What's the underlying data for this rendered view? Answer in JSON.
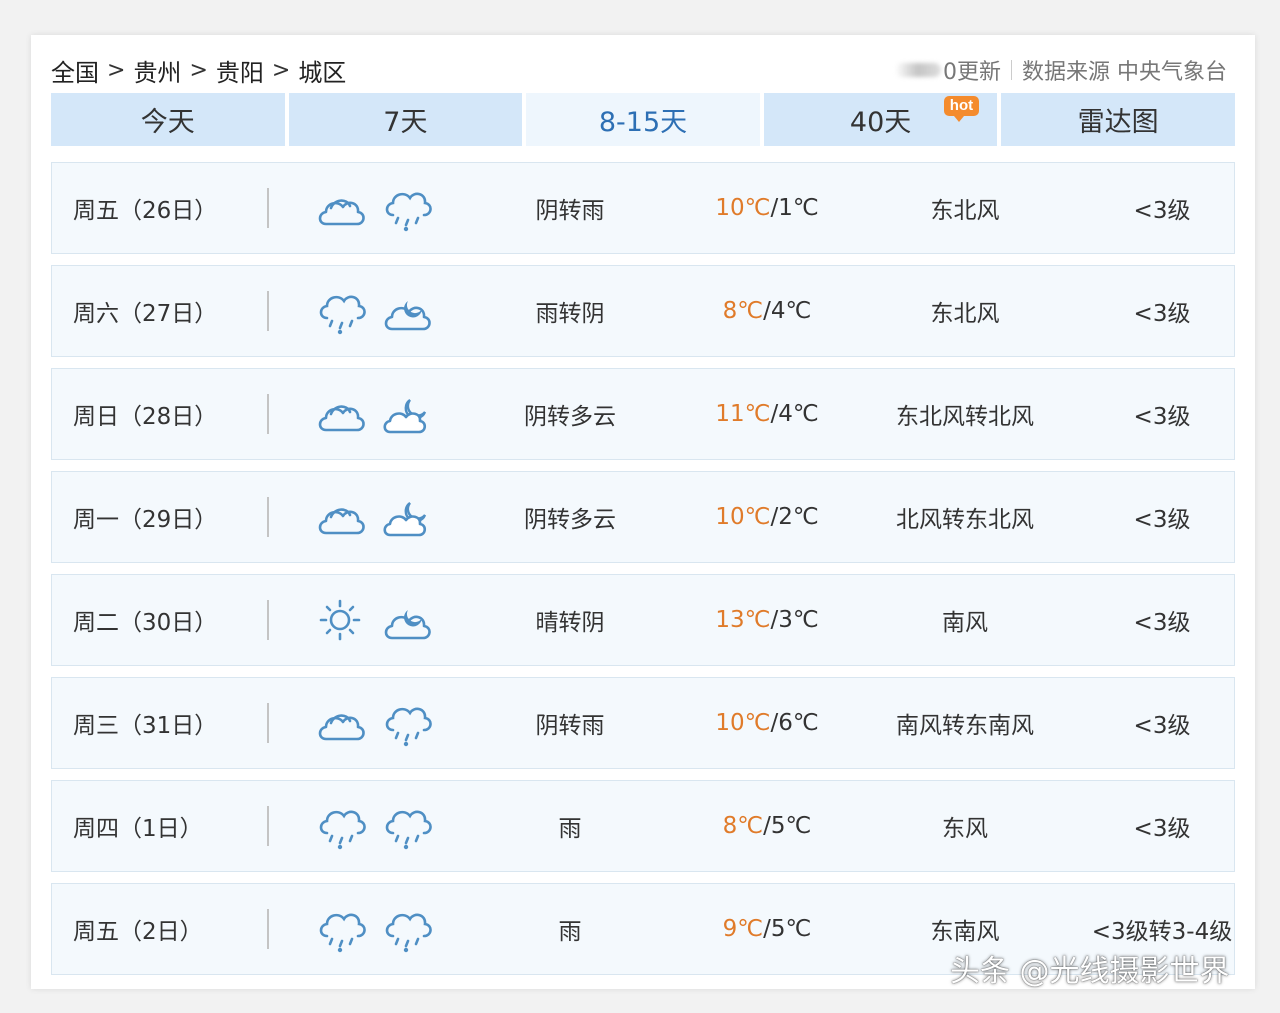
{
  "breadcrumb": [
    "全国",
    "贵州",
    "贵阳",
    "城区"
  ],
  "breadcrumb_sep": ">",
  "update_text": "0更新",
  "source_text": "数据来源 中央气象台",
  "tabs": [
    {
      "label": "今天",
      "active": false
    },
    {
      "label": "7天",
      "active": false
    },
    {
      "label": "8-15天",
      "active": true
    },
    {
      "label": "40天",
      "active": false,
      "badge": "hot"
    },
    {
      "label": "雷达图",
      "active": false
    }
  ],
  "forecast": [
    {
      "date": "周五（26日）",
      "icons": [
        "cloudy-icon",
        "rain-icon"
      ],
      "desc": "阴转雨",
      "high": "10℃",
      "low": "1℃",
      "wind": "东北风",
      "level": "<3级"
    },
    {
      "date": "周六（27日）",
      "icons": [
        "rain-icon",
        "cloudy-night-icon"
      ],
      "desc": "雨转阴",
      "high": "8℃",
      "low": "4℃",
      "wind": "东北风",
      "level": "<3级"
    },
    {
      "date": "周日（28日）",
      "icons": [
        "cloudy-icon",
        "partly-cloudy-night-icon"
      ],
      "desc": "阴转多云",
      "high": "11℃",
      "low": "4℃",
      "wind": "东北风转北风",
      "level": "<3级"
    },
    {
      "date": "周一（29日）",
      "icons": [
        "cloudy-icon",
        "partly-cloudy-night-icon"
      ],
      "desc": "阴转多云",
      "high": "10℃",
      "low": "2℃",
      "wind": "北风转东北风",
      "level": "<3级"
    },
    {
      "date": "周二（30日）",
      "icons": [
        "sunny-icon",
        "cloudy-night-icon"
      ],
      "desc": "晴转阴",
      "high": "13℃",
      "low": "3℃",
      "wind": "南风",
      "level": "<3级"
    },
    {
      "date": "周三（31日）",
      "icons": [
        "cloudy-icon",
        "rain-icon"
      ],
      "desc": "阴转雨",
      "high": "10℃",
      "low": "6℃",
      "wind": "南风转东南风",
      "level": "<3级"
    },
    {
      "date": "周四（1日）",
      "icons": [
        "rain-icon",
        "rain-icon"
      ],
      "desc": "雨",
      "high": "8℃",
      "low": "5℃",
      "wind": "东风",
      "level": "<3级"
    },
    {
      "date": "周五（2日）",
      "icons": [
        "rain-icon",
        "rain-icon"
      ],
      "desc": "雨",
      "high": "9℃",
      "low": "5℃",
      "wind": "东南风",
      "level": "<3级转3-4级"
    }
  ],
  "watermark": "头条 @光线摄影世界",
  "colors": {
    "tab_bg": "#d4e7f9",
    "tab_active_text": "#2d6fb4",
    "high_temp": "#e07b2a",
    "hot_badge": "#f48b2d",
    "icon_stroke": "#4f8fc4"
  }
}
